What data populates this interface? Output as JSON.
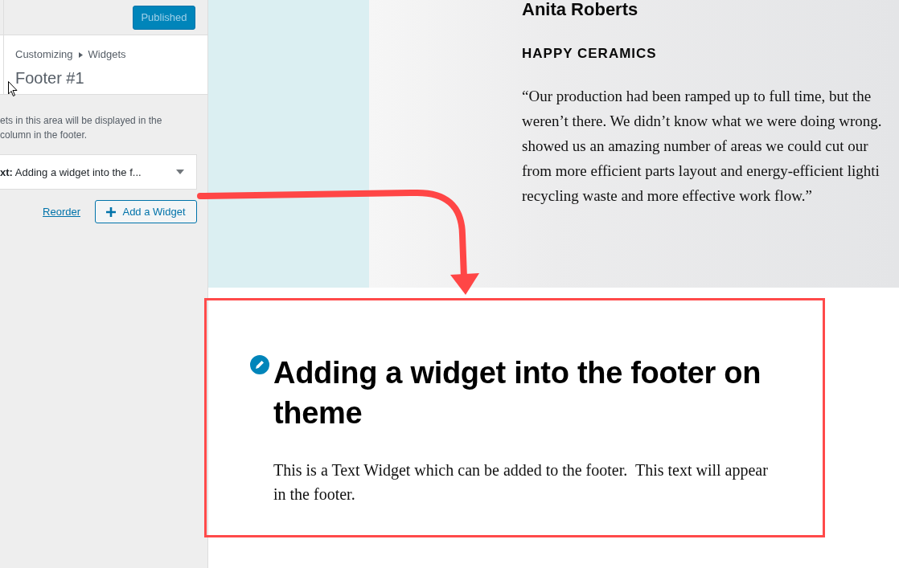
{
  "customizer": {
    "publish_button": {
      "label": "Published",
      "disabled": true
    },
    "breadcrumb": [
      "Customizing",
      "Widgets"
    ],
    "section_title": "Footer #1",
    "description": "ets in this area will be displayed in the column in the footer.",
    "widgets": [
      {
        "title": "**xt:** Adding a widget into the f...",
        "expanded": false
      }
    ],
    "reorder_link": "Reorder",
    "add_widget_button": "Add a Widget"
  },
  "preview": {
    "testimonial": {
      "name": "Anita Roberts",
      "company": "HAPPY CERAMICS",
      "quote_lines": [
        "“Our production had been ramped up to full time, but the",
        "weren’t there. We didn’t know what we were doing wrong.",
        "showed us an amazing number of areas we could cut our",
        "from more efficient parts layout and energy-efficient lighti",
        "recycling waste and more effective work flow.”"
      ]
    },
    "footer_widget": {
      "title": "Adding a widget into the footer on theme",
      "text": "This is a Text Widget which can be added to the footer.  This text will appear in the footer."
    }
  }
}
